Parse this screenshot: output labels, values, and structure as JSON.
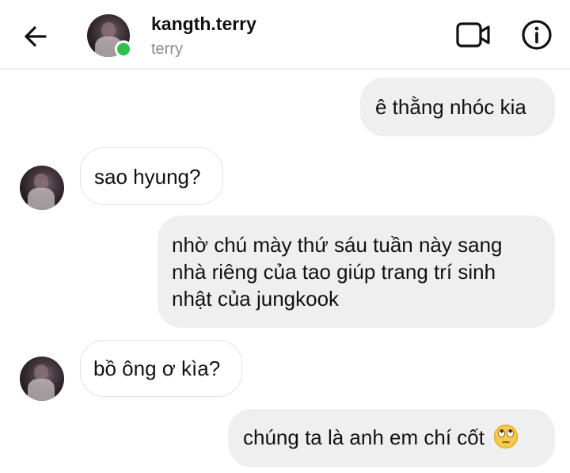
{
  "header": {
    "username": "kangth.terry",
    "subtitle": "terry",
    "online": true,
    "online_color": "#2fc14e"
  },
  "icons": {
    "back": "back-arrow-icon",
    "video": "video-call-icon",
    "info": "info-icon"
  },
  "messages": [
    {
      "direction": "outgoing",
      "text": "ê thằng nhóc kia"
    },
    {
      "direction": "incoming",
      "text": "sao hyung?"
    },
    {
      "direction": "outgoing",
      "lines": [
        "nhờ chú mày thứ sáu tuần này sang",
        "nhà riêng của tao giúp trang trí sinh",
        "nhật của jungkook"
      ]
    },
    {
      "direction": "incoming",
      "text": "bồ ông ơ kìa?"
    },
    {
      "direction": "outgoing",
      "text": "chúng ta là anh em chí cốt",
      "emoji": "face-with-rolling-eyes"
    }
  ],
  "colors": {
    "outgoing_bubble": "#efefef",
    "incoming_border": "#e3e3e3",
    "subtitle": "#8e8e8e"
  }
}
